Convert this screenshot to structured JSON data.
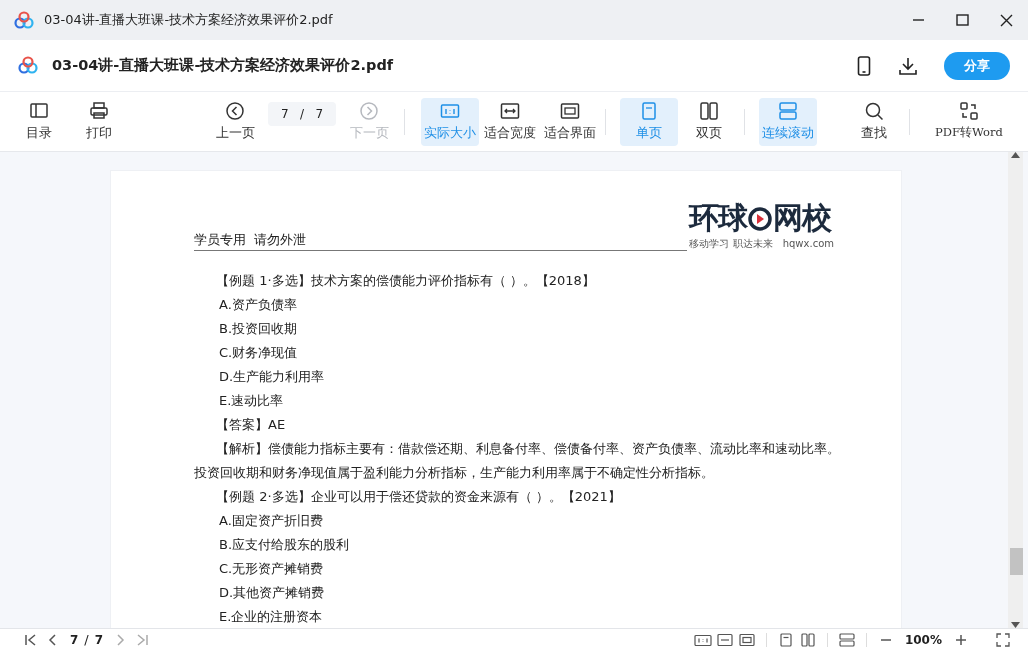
{
  "window": {
    "title": "03-04讲-直播大班课-技术方案经济效果评价2.pdf"
  },
  "header": {
    "title": "03-04讲-直播大班课-技术方案经济效果评价2.pdf",
    "share_button": "分享"
  },
  "toolbar": {
    "groups": [
      {
        "divider": false,
        "items": [
          {
            "kind": "button",
            "label": "目录",
            "selected": false,
            "disabled": false
          },
          {
            "kind": "button",
            "label": "打印",
            "selected": false,
            "disabled": false
          }
        ]
      },
      {
        "divider": false,
        "items": [
          {
            "kind": "button",
            "label": "上一页",
            "selected": false,
            "disabled": false
          },
          {
            "kind": "page",
            "current": "7",
            "separator": "/",
            "total": "7"
          },
          {
            "kind": "button",
            "label": "下一页",
            "selected": false,
            "disabled": true
          }
        ]
      },
      {
        "divider": true,
        "items": [
          {
            "kind": "button",
            "label": "实际大小",
            "selected": true,
            "disabled": false
          },
          {
            "kind": "button",
            "label": "适合宽度",
            "selected": false,
            "disabled": false
          },
          {
            "kind": "button",
            "label": "适合界面",
            "selected": false,
            "disabled": false
          }
        ]
      },
      {
        "divider": true,
        "items": [
          {
            "kind": "button",
            "label": "单页",
            "selected": true,
            "disabled": false
          },
          {
            "kind": "button",
            "label": "双页",
            "selected": false,
            "disabled": false
          }
        ]
      },
      {
        "divider": true,
        "items": [
          {
            "kind": "button",
            "label": "连续滚动",
            "selected": true,
            "disabled": false
          }
        ]
      },
      {
        "divider": false,
        "items": [
          {
            "kind": "button",
            "label": "查找",
            "selected": false,
            "disabled": false
          }
        ]
      },
      {
        "divider": true,
        "items": [
          {
            "kind": "button",
            "label": "PDF转Word",
            "selected": false,
            "disabled": false
          }
        ]
      }
    ]
  },
  "document": {
    "header_text": "学员专用  请勿外泄",
    "logo": {
      "name_left": "环球",
      "name_right": "网校",
      "tagline": "移动学习 职达未来",
      "url": "hqwx.com"
    },
    "lines": [
      {
        "kind": "question",
        "text": "【例题 1·多选】技术方案的偿债能力评价指标有（    ）。【2018】"
      },
      {
        "kind": "option",
        "text": "A.资产负债率"
      },
      {
        "kind": "option",
        "text": "B.投资回收期"
      },
      {
        "kind": "option",
        "text": "C.财务净现值"
      },
      {
        "kind": "option",
        "text": "D.生产能力利用率"
      },
      {
        "kind": "option",
        "text": "E.速动比率"
      },
      {
        "kind": "question",
        "text": "【答案】AE"
      },
      {
        "kind": "paragraph",
        "text": "【解析】偿债能力指标主要有：借款偿还期、利息备付率、偿债备付率、资产负债率、流动比率和速动比率。投资回收期和财务净现值属于盈利能力分析指标，生产能力利用率属于不确定性分析指标。"
      },
      {
        "kind": "question",
        "text": "【例题 2·多选】企业可以用于偿还贷款的资金来源有（    ）。【2021】"
      },
      {
        "kind": "option",
        "text": "A.固定资产折旧费"
      },
      {
        "kind": "option",
        "text": "B.应支付给股东的股利"
      },
      {
        "kind": "option",
        "text": "C.无形资产摊销费"
      },
      {
        "kind": "option",
        "text": "D.其他资产摊销费"
      },
      {
        "kind": "option",
        "text": "E.企业的注册资本"
      }
    ]
  },
  "status_bar": {
    "current_page": "7",
    "separator": "/",
    "total_pages": "7",
    "zoom": "100%"
  }
}
